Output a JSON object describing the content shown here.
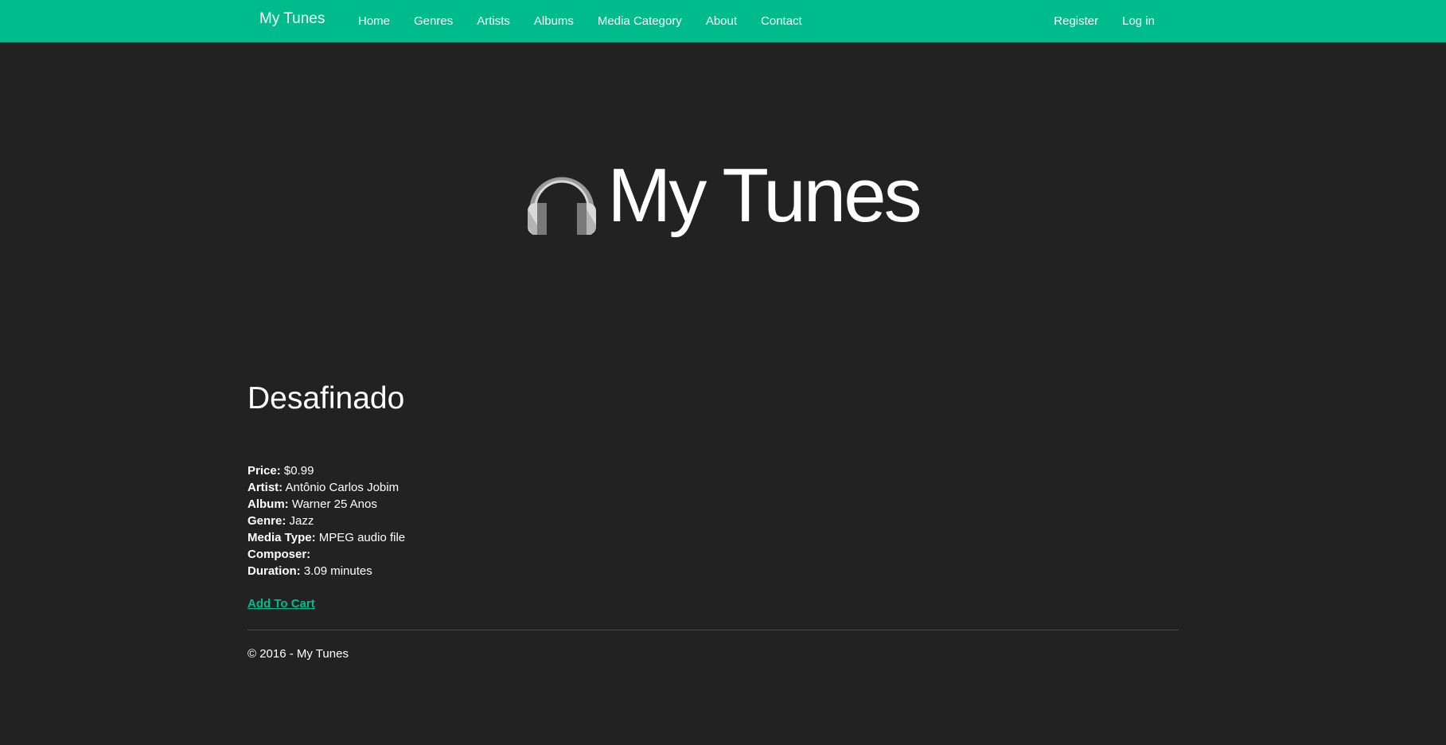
{
  "navbar": {
    "brand": "My Tunes",
    "links": [
      "Home",
      "Genres",
      "Artists",
      "Albums",
      "Media Category",
      "About",
      "Contact"
    ],
    "right_links": [
      "Register",
      "Log in"
    ],
    "background": "#00bc8c"
  },
  "hero": {
    "title": "My Tunes",
    "icon": "headphones-icon"
  },
  "track": {
    "title": "Desafinado",
    "price_label": "Price:",
    "price": "$0.99",
    "artist_label": "Artist:",
    "artist": "Antônio Carlos Jobim",
    "album_label": "Album:",
    "album": "Warner 25 Anos",
    "genre_label": "Genre:",
    "genre": "Jazz",
    "media_type_label": "Media Type:",
    "media_type": "MPEG audio file",
    "composer_label": "Composer:",
    "composer": "",
    "duration_label": "Duration:",
    "duration": "3.09 minutes",
    "add_to_cart": "Add To Cart"
  },
  "footer": {
    "text": "© 2016 - My Tunes"
  },
  "colors": {
    "accent": "#00bc8c",
    "background": "#222222"
  }
}
